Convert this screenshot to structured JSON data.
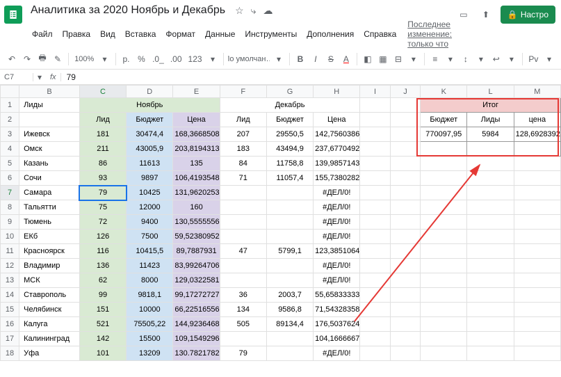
{
  "header": {
    "doc_title": "Аналитика за  2020 Ноябрь и Декабрь",
    "menu": [
      "Файл",
      "Правка",
      "Вид",
      "Вставка",
      "Формат",
      "Данные",
      "Инструменты",
      "Дополнения",
      "Справка"
    ],
    "last_edit": "Последнее изменение: только что",
    "share_label": "Настро"
  },
  "toolbar": {
    "zoom": "100%",
    "currency_rub": "р.",
    "percent": "%",
    "dec_less": ".0_",
    "dec_more": ".00",
    "fmt_more": "123",
    "font": "По умолчан…",
    "bold": "B",
    "italic": "I",
    "strike": "S",
    "text_color": "A",
    "pv": "Рv"
  },
  "formula_bar": {
    "name_box": "C7",
    "fx_label": "fx",
    "value": "79"
  },
  "columns": [
    "B",
    "C",
    "D",
    "E",
    "F",
    "G",
    "H",
    "I",
    "J",
    "K",
    "L",
    "M"
  ],
  "sheet": {
    "r1_B": "Лиды",
    "r1_nov": "Ноябрь",
    "r1_dec": "Декабрь",
    "r1_itog": "Итог",
    "r2": {
      "C": "Лид",
      "D": "Бюджет",
      "E": "Цена",
      "F": "Лид",
      "G": "Бюджет",
      "H": "Цена",
      "K": "Бюджет",
      "L": "Лиды",
      "M": "цена"
    },
    "summary": {
      "K": "770097,95",
      "L": "5984",
      "M": "128,6928392"
    },
    "rows": [
      {
        "n": 3,
        "B": "Ижевск",
        "C": "181",
        "D": "30474,4",
        "E": "168,3668508",
        "F": "207",
        "G": "29550,5",
        "H": "142,7560386"
      },
      {
        "n": 4,
        "B": "Омск",
        "C": "211",
        "D": "43005,9",
        "E": "203,8194313",
        "F": "183",
        "G": "43494,9",
        "H": "237,6770492"
      },
      {
        "n": 5,
        "B": "Казань",
        "C": "86",
        "D": "11613",
        "E": "135",
        "F": "84",
        "G": "11758,8",
        "H": "139,9857143"
      },
      {
        "n": 6,
        "B": "Сочи",
        "C": "93",
        "D": "9897",
        "E": "106,4193548",
        "F": "71",
        "G": "11057,4",
        "H": "155,7380282"
      },
      {
        "n": 7,
        "B": "Самара",
        "C": "79",
        "D": "10425",
        "E": "131,9620253",
        "F": "",
        "G": "",
        "H": "#ДЕЛ/0!"
      },
      {
        "n": 8,
        "B": "Тальятти",
        "C": "75",
        "D": "12000",
        "E": "160",
        "F": "",
        "G": "",
        "H": "#ДЕЛ/0!"
      },
      {
        "n": 9,
        "B": "Тюмень",
        "C": "72",
        "D": "9400",
        "E": "130,5555556",
        "F": "",
        "G": "",
        "H": "#ДЕЛ/0!"
      },
      {
        "n": 10,
        "B": "ЕКб",
        "C": "126",
        "D": "7500",
        "E": "59,52380952",
        "F": "",
        "G": "",
        "H": "#ДЕЛ/0!"
      },
      {
        "n": 11,
        "B": "Красноярск",
        "C": "116",
        "D": "10415,5",
        "E": "89,7887931",
        "F": "47",
        "G": "5799,1",
        "H": "123,3851064"
      },
      {
        "n": 12,
        "B": "Владимир",
        "C": "136",
        "D": "11423",
        "E": "83,99264706",
        "F": "",
        "G": "",
        "H": "#ДЕЛ/0!"
      },
      {
        "n": 13,
        "B": "МСК",
        "C": "62",
        "D": "8000",
        "E": "129,0322581",
        "F": "",
        "G": "",
        "H": "#ДЕЛ/0!"
      },
      {
        "n": 14,
        "B": "Ставрополь",
        "C": "99",
        "D": "9818,1",
        "E": "99,17272727",
        "F": "36",
        "G": "2003,7",
        "H": "55,65833333"
      },
      {
        "n": 15,
        "B": "Челябинск",
        "C": "151",
        "D": "10000",
        "E": "66,22516556",
        "F": "134",
        "G": "9586,8",
        "H": "71,54328358"
      },
      {
        "n": 16,
        "B": "Калуга",
        "C": "521",
        "D": "75505,22",
        "E": "144,9236468",
        "F": "505",
        "G": "89134,4",
        "H": "176,5037624"
      },
      {
        "n": 17,
        "B": "Калининград",
        "C": "142",
        "D": "15500",
        "E": "109,1549296",
        "F": "",
        "G": "",
        "H": "104,1666667"
      },
      {
        "n": 18,
        "B": "Уфа",
        "C": "101",
        "D": "13209",
        "E": "130.7821782",
        "F": "79",
        "G": "",
        "H": "#ДЕЛ/0!"
      }
    ]
  }
}
